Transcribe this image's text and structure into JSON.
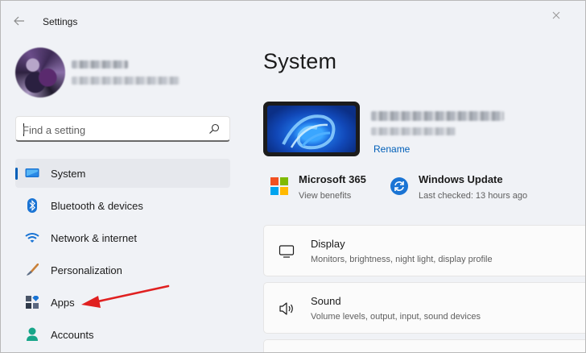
{
  "window": {
    "title": "Settings",
    "back_icon": "back-arrow-icon",
    "close_icon": "close-icon"
  },
  "profile": {
    "name": "",
    "email": "",
    "avatar": "user-avatar"
  },
  "search": {
    "placeholder": "Find a setting",
    "value": "",
    "icon": "search-icon"
  },
  "sidebar": {
    "accent_color": "#005fb8",
    "items": [
      {
        "label": "System",
        "icon": "system-monitor-icon",
        "selected": true
      },
      {
        "label": "Bluetooth & devices",
        "icon": "bluetooth-icon",
        "selected": false
      },
      {
        "label": "Network & internet",
        "icon": "wifi-icon",
        "selected": false
      },
      {
        "label": "Personalization",
        "icon": "brush-icon",
        "selected": false
      },
      {
        "label": "Apps",
        "icon": "apps-icon",
        "selected": false
      },
      {
        "label": "Accounts",
        "icon": "accounts-icon",
        "selected": false
      }
    ]
  },
  "annotation": {
    "arrow_color": "#e02020",
    "points_to": "Apps"
  },
  "main": {
    "title": "System",
    "device": {
      "name": "",
      "model": "",
      "rename_label": "Rename"
    },
    "quick_links": [
      {
        "title": "Microsoft 365",
        "subtitle": "View benefits",
        "icon": "microsoft-logo-icon"
      },
      {
        "title": "Windows Update",
        "subtitle": "Last checked: 13 hours ago",
        "icon": "windows-update-icon"
      }
    ],
    "cards": [
      {
        "title": "Display",
        "subtitle": "Monitors, brightness, night light, display profile",
        "icon": "display-icon"
      },
      {
        "title": "Sound",
        "subtitle": "Volume levels, output, input, sound devices",
        "icon": "speaker-icon"
      }
    ]
  }
}
